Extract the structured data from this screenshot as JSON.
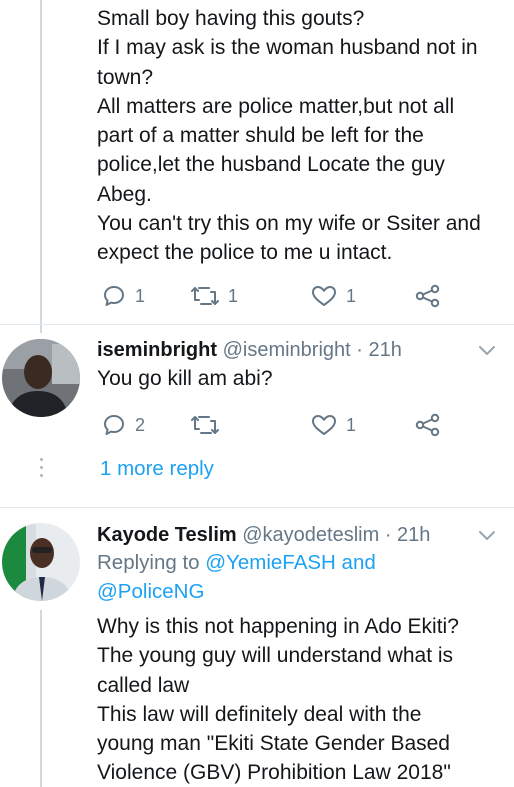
{
  "tweets": [
    {
      "text_lines": [
        "Small boy having this gouts?",
        "If I may ask is the woman husband not in",
        "town?",
        "All matters are police matter,but not all",
        "part of a matter shuld be left for the",
        "police,let the husband Locate the guy",
        "Abeg.",
        "You can't try this on my wife or Ssiter and",
        "expect the police to me u intact."
      ],
      "actions": {
        "reply_count": "1",
        "retweet_count": "1",
        "like_count": "1"
      }
    },
    {
      "display_name": "iseminbright",
      "handle": "@iseminbright",
      "time": "· 21h",
      "text": "You go kill am abi?",
      "actions": {
        "reply_count": "2",
        "retweet_count": "",
        "like_count": "1"
      }
    },
    {
      "display_name": "Kayode Teslim",
      "handle": "@kayodeteslim",
      "time": "· 21h",
      "replying_prefix": "Replying to",
      "replying_user1": "@YemieFASH",
      "replying_and": "and",
      "replying_user2": "@PoliceNG",
      "text_lines": [
        "Why is this not happening in Ado Ekiti?",
        "The young guy will understand what is",
        "called law",
        "This law will definitely deal with the",
        "young man \"Ekiti State Gender Based",
        "Violence (GBV) Prohibition Law 2018\""
      ]
    }
  ],
  "more_replies": "1 more reply",
  "colors": {
    "text": "#14171a",
    "secondary": "#657786",
    "link": "#1da1f2",
    "divider": "#e1e8ed",
    "thread_line": "#cfd9de"
  },
  "icons": [
    "reply-icon",
    "retweet-icon",
    "like-icon",
    "share-icon",
    "chevron-down-icon"
  ]
}
